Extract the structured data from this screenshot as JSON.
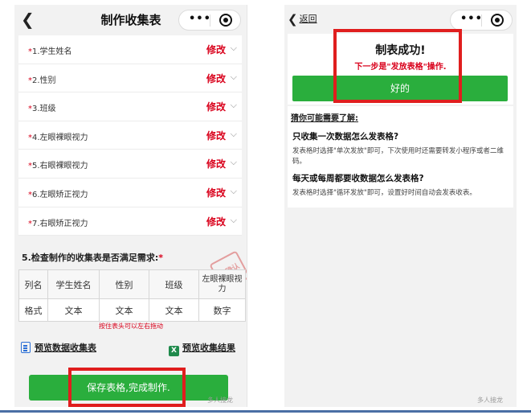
{
  "left": {
    "title": "制作收集表",
    "fields": [
      {
        "star": "*",
        "label": "1.学生姓名",
        "action": "修改"
      },
      {
        "star": "*",
        "label": "2.性别",
        "action": "修改"
      },
      {
        "star": "*",
        "label": "3.班级",
        "action": "修改"
      },
      {
        "star": "*",
        "label": "4.左眼裸眼视力",
        "action": "修改"
      },
      {
        "star": "*",
        "label": "5.右眼裸眼视力",
        "action": "修改"
      },
      {
        "star": "*",
        "label": "6.左眼矫正视力",
        "action": "修改"
      },
      {
        "star": "*",
        "label": "7.右眼矫正视力",
        "action": "修改"
      }
    ],
    "question": "5.检查制作的收集表是否满足需求:",
    "question_star": "*",
    "stamp": "已确认",
    "table": {
      "headers": [
        "列名",
        "学生姓名",
        "性别",
        "班级",
        "左眼裸眼视力"
      ],
      "row": [
        "格式",
        "文本",
        "文本",
        "文本",
        "数字"
      ]
    },
    "hint": "按住表头可以左右拖动",
    "preview_form_link": "预览数据收集表",
    "preview_result_link": "预览收集结果",
    "excel_icon": "X",
    "save_button": "保存表格,完成制作.",
    "watermark": "多人接龙"
  },
  "right": {
    "back_label": "返回",
    "success_title": "制表成功!",
    "success_sub": "下一步是\"发放表格\"操作.",
    "ok_button": "好的",
    "faq_head": "猜你可能需要了解:",
    "faq": [
      {
        "q": "只收集一次数据怎么发表格?",
        "a": "发表格时选择\"单次发放\"即可，下次使用时还需要转发小程序或者二维码。"
      },
      {
        "q": "每天或每周都要收数据怎么发表格?",
        "a": "发表格时选择\"循环发放\"即可，设置好时间自动会发表收表。"
      }
    ],
    "watermark": "多人接龙"
  },
  "colors": {
    "accent_green": "#2aae3d",
    "highlight_red": "#e01e1e",
    "required_red": "#d9001b"
  },
  "icons": {
    "back": "chevron-left-icon",
    "menu": "more-dots-icon",
    "close": "target-icon",
    "form": "document-icon",
    "excel": "excel-icon",
    "dropdown": "chevron-down-icon"
  }
}
